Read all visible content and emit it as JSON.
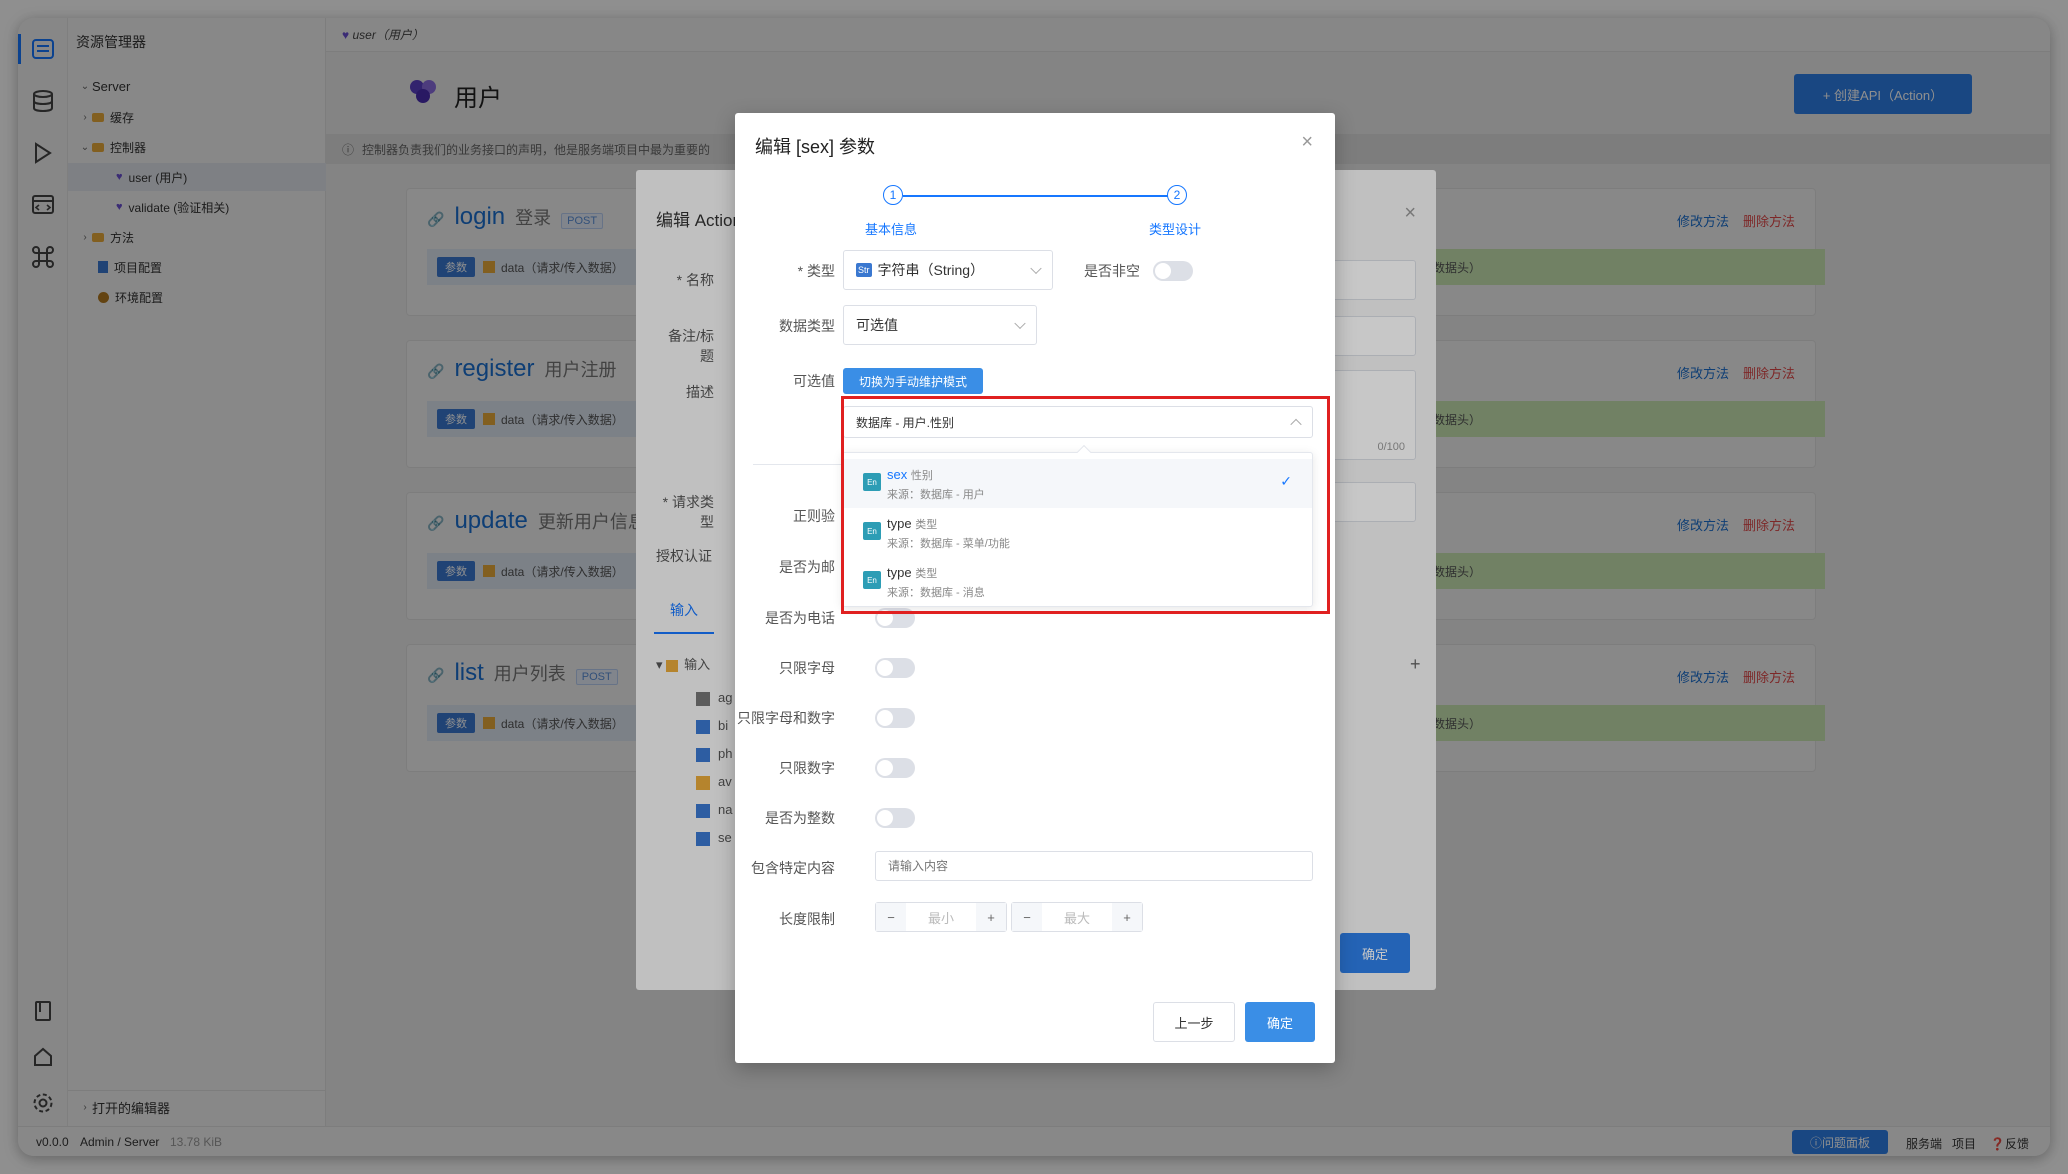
{
  "explorer": {
    "title": "资源管理器",
    "items": [
      {
        "label": "Server"
      },
      {
        "label": "缓存"
      },
      {
        "label": "控制器"
      },
      {
        "label": "user (用户)"
      },
      {
        "label": "validate (验证相关)"
      },
      {
        "label": "方法"
      },
      {
        "label": "项目配置"
      },
      {
        "label": "环境配置"
      }
    ],
    "open_editors": "打开的编辑器"
  },
  "tab": {
    "label": "user（用户）"
  },
  "page": {
    "title": "用户",
    "create_button": "+ 创建API（Action）",
    "notice": "控制器负责我们的业务接口的声明，他是服务端项目中最为重要的"
  },
  "methods": [
    {
      "name": "login",
      "desc": "登录",
      "tag": "POST"
    },
    {
      "name": "register",
      "desc": "用户注册",
      "tag": ""
    },
    {
      "name": "update",
      "desc": "更新用户信息",
      "tag": ""
    },
    {
      "name": "list",
      "desc": "用户列表",
      "tag": "POST"
    }
  ],
  "method_row": {
    "param_tag": "参数",
    "data_text": "data（请求/传入数据）",
    "right_text": "（返回数据头）"
  },
  "method_actions": {
    "edit": "修改方法",
    "delete": "删除方法"
  },
  "bg_dialog": {
    "title": "编辑 Action",
    "labels": [
      "* 名称",
      "备注/标题",
      "描述",
      "* 请求类型",
      "授权认证"
    ],
    "tab_input": "输入",
    "tree_root": "输入",
    "counter": "0/100",
    "tree_rows": [
      "ag",
      "bi",
      "ph",
      "av",
      "na",
      "se"
    ],
    "confirm": "确定"
  },
  "dialog": {
    "title": "编辑 [sex] 参数",
    "steps": [
      {
        "num": "1",
        "label": "基本信息"
      },
      {
        "num": "2",
        "label": "类型设计"
      }
    ],
    "type_label": "* 类型",
    "type_badge": "Str",
    "type_value": "字符串（String）",
    "not_null_label": "是否非空",
    "data_type_label": "数据类型",
    "data_type_value": "可选值",
    "options_label": "可选值",
    "switch_button": "切换为手动维护模式",
    "select_value": "数据库 - 用户.性别",
    "regex_label": "正则验",
    "email_label": "是否为邮",
    "phone_label": "是否为电话",
    "letters_label": "只限字母",
    "alnum_label": "只限字母和数字",
    "digits_label": "只限数字",
    "integer_label": "是否为整数",
    "contains_label": "包含特定内容",
    "contains_placeholder": "请输入内容",
    "length_label": "长度限制",
    "min_placeholder": "最小",
    "max_placeholder": "最大",
    "prev_button": "上一步",
    "ok_button": "确定",
    "dropdown": [
      {
        "badge": "En",
        "name": "sex",
        "label": "性别",
        "source": "来源：数据库 - 用户"
      },
      {
        "badge": "En",
        "name": "type",
        "label": "类型",
        "source": "来源：数据库 - 菜单/功能"
      },
      {
        "badge": "En",
        "name": "type",
        "label": "类型",
        "source": "来源：数据库 - 消息"
      }
    ]
  },
  "statusbar": {
    "version": "v0.0.0",
    "path": "Admin / Server",
    "size": "13.78 KiB",
    "problems": "问题面板",
    "server": "服务端",
    "project": "项目",
    "feedback": "反馈"
  }
}
